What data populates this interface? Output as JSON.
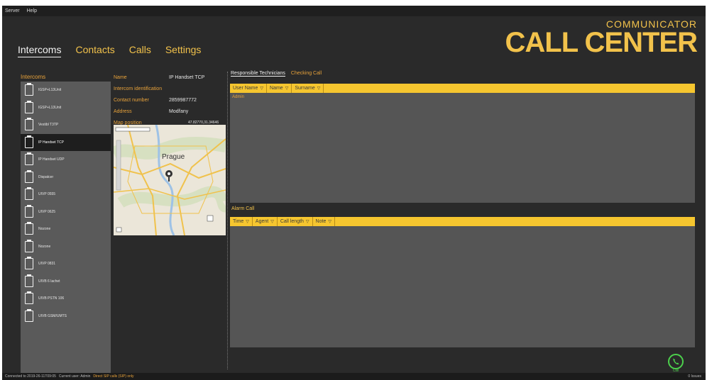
{
  "menu": [
    "Server",
    "Help"
  ],
  "brand": {
    "line1": "COMMUNICATOR",
    "line2": "CALL CENTER",
    "color": "#f2c24b"
  },
  "nav": {
    "tabs": [
      "Intercoms",
      "Contacts",
      "Calls",
      "Settings"
    ],
    "active": "Intercoms"
  },
  "sidebar": {
    "title": "Intercoms",
    "items": [
      {
        "label": "IGSP+L13Unit"
      },
      {
        "label": "IGSP+L13Unit"
      },
      {
        "label": "Vestibl T3TP"
      },
      {
        "label": "IP Handset TCP"
      },
      {
        "label": "IP Handset UDP"
      },
      {
        "label": "Dispatcer"
      },
      {
        "label": "UIVP 0555"
      },
      {
        "label": "UIVP 0625"
      },
      {
        "label": "Nozone"
      },
      {
        "label": "Nozone"
      },
      {
        "label": "UIVP 0831"
      },
      {
        "label": "UIVB 6 lachet"
      },
      {
        "label": "UIVB PSTN 106"
      },
      {
        "label": "UIVB GSM/UMTS"
      }
    ],
    "selected_index": 3
  },
  "details": {
    "name_label": "Name",
    "name_value": "IP Handset TCP",
    "ident_label": "Intercom identification",
    "contact_label": "Contact number",
    "contact_value": "2859987772",
    "address_label": "Address",
    "address_value": "Modřany",
    "mappos_label": "Map position",
    "mappos_value": "47.82770,31.34646"
  },
  "map": {
    "city_label": "Prague"
  },
  "right_tabs": [
    "Responsible Technicians",
    "Checking Call"
  ],
  "technicians": {
    "columns": [
      "User Name",
      "Name",
      "Surname"
    ],
    "rows": [
      "Admin"
    ]
  },
  "alarm": {
    "title": "Alarm Call",
    "columns": [
      "Time",
      "Agent",
      "Call length",
      "Note"
    ]
  },
  "call_button": {
    "label": "Call",
    "color": "#4cd04c"
  },
  "status": {
    "connected": "Connected to 2019-26-11T09:05 ",
    "user": "Current user: Admin ",
    "link": "Direct SIP calls (SIP) only",
    "right": "0 Issues"
  }
}
